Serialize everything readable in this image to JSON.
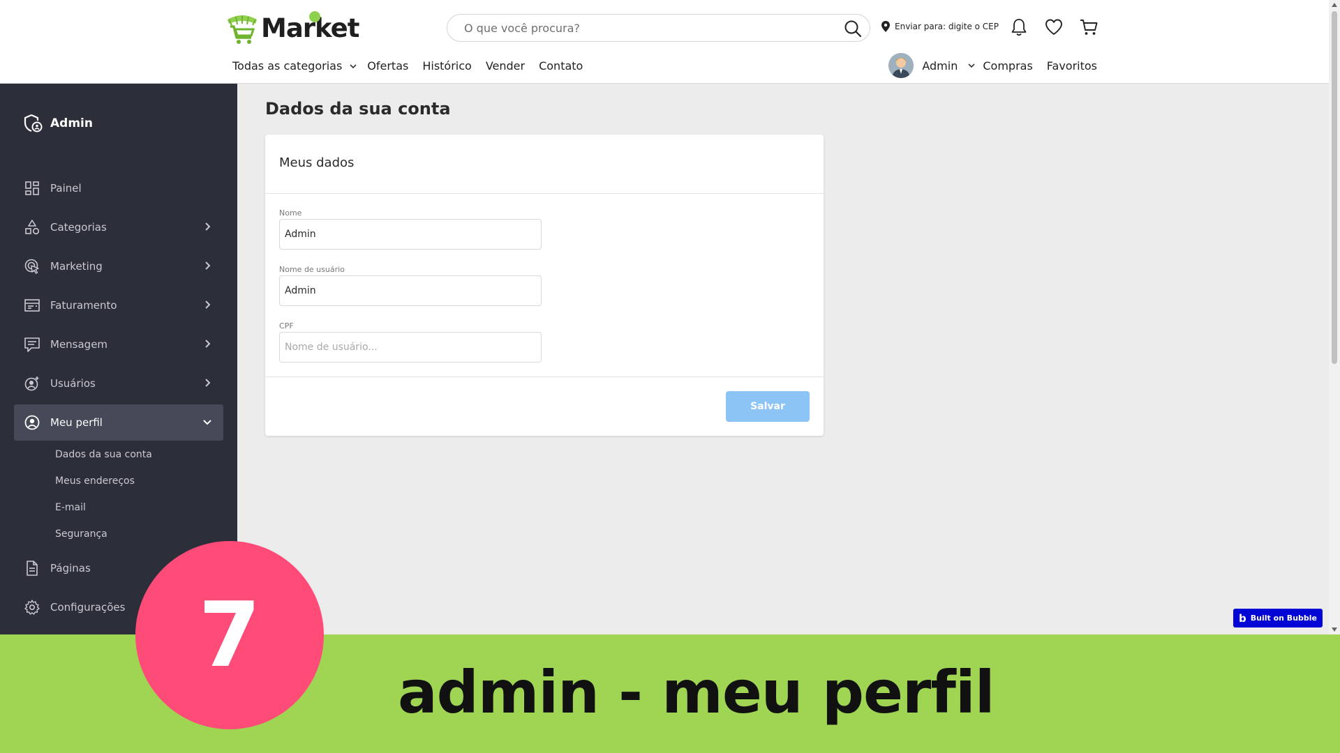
{
  "header": {
    "logo_text": "Market",
    "search_placeholder": "O que você procura?",
    "ship_to": "Enviar para: digite o CEP",
    "nav": {
      "categories": "Todas as categorias",
      "offers": "Ofertas",
      "history": "Histórico",
      "sell": "Vender",
      "contact": "Contato"
    },
    "user_name": "Admin",
    "purchases": "Compras",
    "favorites": "Favoritos",
    "icons": [
      "search-icon",
      "location-pin-icon",
      "bell-icon",
      "heart-icon",
      "cart-icon"
    ]
  },
  "sidebar": {
    "brand": "Admin",
    "items": {
      "panel": "Painel",
      "categories": "Categorias",
      "marketing": "Marketing",
      "billing": "Faturamento",
      "messages": "Mensagem",
      "users": "Usuários",
      "profile": "Meu perfil",
      "pages": "Páginas",
      "settings": "Configurações"
    },
    "profile_sub": {
      "account": "Dados da sua conta",
      "addresses": "Meus endereços",
      "email": "E-mail",
      "security": "Segurança"
    }
  },
  "main": {
    "title": "Dados da sua conta",
    "card_title": "Meus dados",
    "fields": {
      "name_label": "Nome",
      "name_value": "Admin",
      "username_label": "Nome de usuário",
      "username_value": "Admin",
      "cpf_label": "CPF",
      "cpf_placeholder": "Nome de usuário..."
    },
    "save_label": "Salvar"
  },
  "bubble_badge": "Built on Bubble",
  "banner": {
    "number": "7",
    "text": "admin - meu perfil"
  },
  "colors": {
    "sidebar_bg": "#2c2e3a",
    "main_bg": "#ececec",
    "save_button": "#8cc5f5",
    "banner_bg": "#a0d554",
    "badge_circle": "#ff4b78",
    "logo_green": "#8fd14f"
  }
}
